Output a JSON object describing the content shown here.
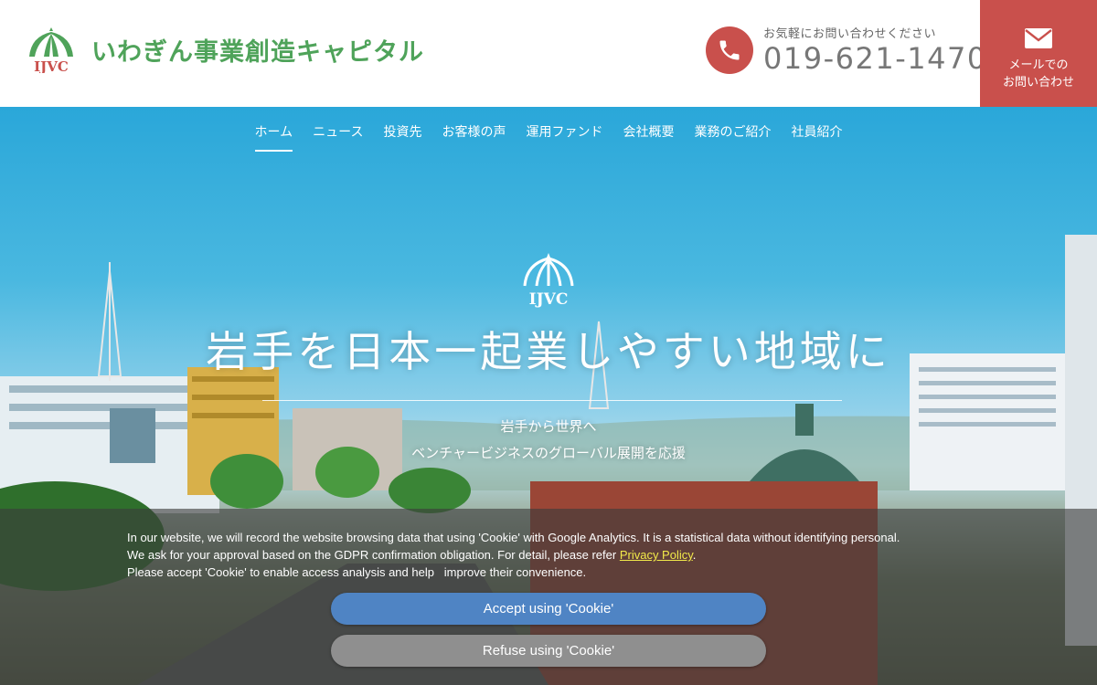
{
  "header": {
    "logo_text": "いわぎん事業創造キャピタル",
    "logo_mark_text": "IJVC",
    "phone_caption": "お気軽にお問い合わせください",
    "phone_number": "019-621-1470",
    "mail_label_line1": "メールでの",
    "mail_label_line2": "お問い合わせ"
  },
  "nav": {
    "items": [
      "ホーム",
      "ニュース",
      "投資先",
      "お客様の声",
      "運用ファンド",
      "会社概要",
      "業務のご紹介",
      "社員紹介"
    ],
    "active": "ホーム"
  },
  "hero": {
    "logo_text": "IJVC",
    "title": "岩手を日本一起業しやすい地域に",
    "subtitle_line1": "岩手から世界へ",
    "subtitle_line2": "ベンチャービジネスのグローバル展開を応援"
  },
  "cookie": {
    "line1": "In our website, we will record the website browsing data that using 'Cookie' with Google Analytics. It is a statistical data without identifying personal.",
    "line2_before": "We ask for your approval based on the GDPR confirmation obligation. For detail, please refer ",
    "privacy_link": "Privacy Policy",
    "line2_after": ".",
    "line3": "Please accept 'Cookie' to enable access analysis and help   improve their convenience.",
    "accept_label": "Accept using 'Cookie'",
    "refuse_label": "Refuse using 'Cookie'"
  },
  "colors": {
    "brand_green": "#4fa35a",
    "brand_red": "#c9504c",
    "accept_blue": "#4f84c4",
    "link_yellow": "#f2ea4a"
  },
  "icons": {
    "phone": "phone-icon",
    "mail": "envelope-icon",
    "logo": "dome-logo-icon"
  }
}
